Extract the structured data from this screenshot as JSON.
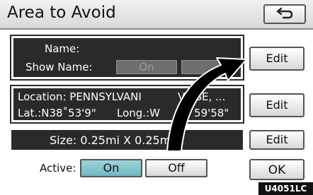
{
  "header": {
    "title": "Area to Avoid",
    "back_icon": "return-arrow-icon"
  },
  "name_section": {
    "name_label": "Name:",
    "show_name_label": "Show Name:",
    "show_name_on": "On",
    "edit_label": "Edit"
  },
  "location_section": {
    "location_text": "Location: PENNSYLVANI",
    "location_text_tail": "VE SE, ...",
    "coords_left": "Lat.:N38˚53'9\"",
    "coords_long": "Long.:W",
    "coords_tail": "6˚59'58\"",
    "edit_label": "Edit"
  },
  "size_section": {
    "size_text": "Size: 0.25mi X 0.25mi",
    "edit_label": "Edit"
  },
  "active": {
    "label": "Active:",
    "on_label": "On",
    "off_label": "Off",
    "selected": "On"
  },
  "ok_label": "OK",
  "figure_code": "U4051LC",
  "colors": {
    "panel": "#2a2a2a",
    "selected": "#7dc0c9",
    "arrow": "#000000"
  }
}
